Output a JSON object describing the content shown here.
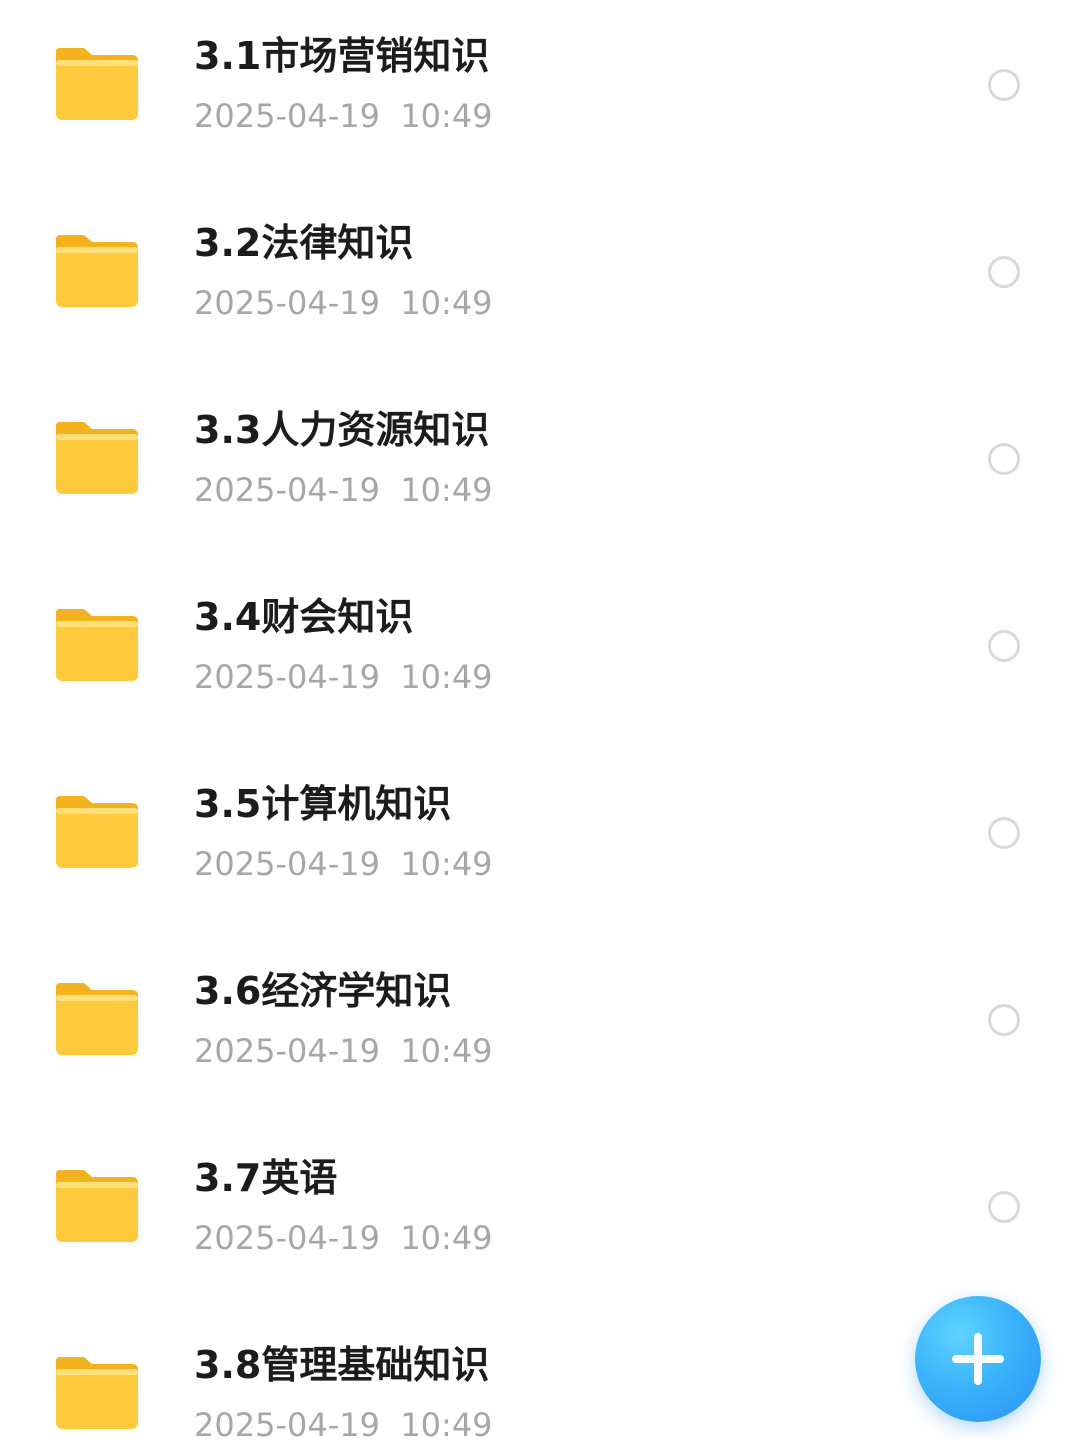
{
  "items": [
    {
      "name": "3.1市场营销知识",
      "date": "2025-04-19  10:49",
      "icon": "folder-icon"
    },
    {
      "name": "3.2法律知识",
      "date": "2025-04-19  10:49",
      "icon": "folder-icon"
    },
    {
      "name": "3.3人力资源知识",
      "date": "2025-04-19  10:49",
      "icon": "folder-icon"
    },
    {
      "name": "3.4财会知识",
      "date": "2025-04-19  10:49",
      "icon": "folder-icon"
    },
    {
      "name": "3.5计算机知识",
      "date": "2025-04-19  10:49",
      "icon": "folder-icon"
    },
    {
      "name": "3.6经济学知识",
      "date": "2025-04-19  10:49",
      "icon": "folder-icon"
    },
    {
      "name": "3.7英语",
      "date": "2025-04-19  10:49",
      "icon": "folder-icon"
    },
    {
      "name": "3.8管理基础知识",
      "date": "2025-04-19  10:49",
      "icon": "folder-icon"
    }
  ],
  "fab": {
    "icon": "plus-icon"
  },
  "colors": {
    "folder": "#fcca3c",
    "fab": "#3ab4fb",
    "title": "#1c1c1c",
    "date": "#a7a7a7",
    "circle": "#d9d9d9"
  }
}
